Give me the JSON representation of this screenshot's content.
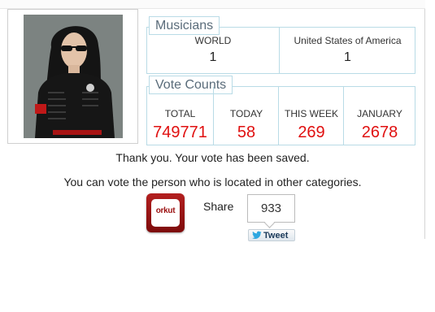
{
  "musicians": {
    "title": "Musicians",
    "columns": [
      {
        "label": "WORLD",
        "value": "1"
      },
      {
        "label": "United States of America",
        "value": "1"
      }
    ]
  },
  "votes": {
    "title": "Vote Counts",
    "columns": [
      {
        "label": "TOTAL",
        "value": "749771"
      },
      {
        "label": "TODAY",
        "value": "58"
      },
      {
        "label": "THIS WEEK",
        "value": "269"
      },
      {
        "label": "JANUARY",
        "value": "2678"
      }
    ]
  },
  "messages": {
    "saved": "Thank you. Your vote has been saved.",
    "other": "You can vote the person who is located in other categories."
  },
  "share": {
    "orkut_label": "orkut",
    "share_label": "Share",
    "count": "933",
    "tweet_label": "Tweet"
  },
  "colors": {
    "accent_border": "#b9dbe6",
    "vote_value": "#e01010",
    "orkut_red": "#9b1111"
  }
}
